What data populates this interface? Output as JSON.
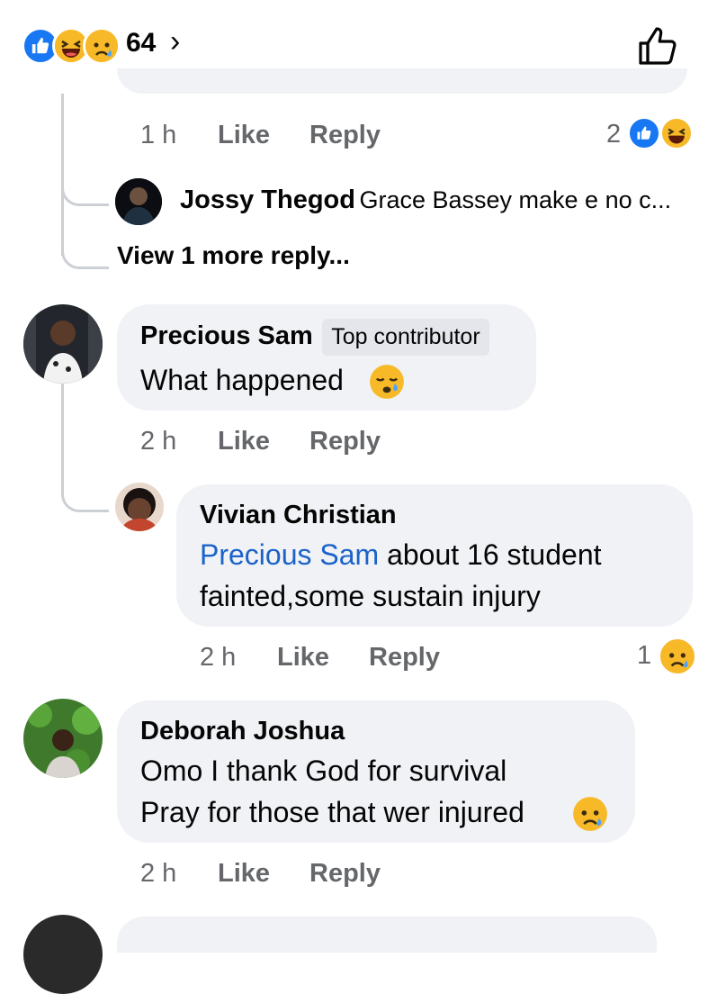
{
  "reactions_bar": {
    "count": "64",
    "icons": [
      "like-icon",
      "haha-icon",
      "sad-icon"
    ],
    "chevron": "›"
  },
  "thread1": {
    "time": "1 h",
    "like": "Like",
    "reply": "Reply",
    "reaction_count": "2",
    "reply_author": "Jossy Thegod",
    "reply_text": "Grace Bassey make e no c...",
    "view_more": "View 1 more reply..."
  },
  "comment_precious": {
    "author": "Precious Sam",
    "badge": "Top contributor",
    "text": "What happened",
    "time": "2 h",
    "like": "Like",
    "reply": "Reply"
  },
  "reply_vivian": {
    "author": "Vivian Christian",
    "mention": "Precious Sam",
    "text_line1": " about 16 student",
    "text_line2": "fainted,some sustain injury",
    "time": "2 h",
    "like": "Like",
    "reply": "Reply",
    "reaction_count": "1"
  },
  "comment_deborah": {
    "author": "Deborah Joshua",
    "text_line1": "Omo I thank God for survival",
    "text_line2": "Pray for those that wer injured",
    "time": "2 h",
    "like": "Like",
    "reply": "Reply"
  },
  "colors": {
    "bubble": "#f0f2f5",
    "meta": "#65676b",
    "like_blue": "#1877f2",
    "mention": "#1b63c9"
  }
}
